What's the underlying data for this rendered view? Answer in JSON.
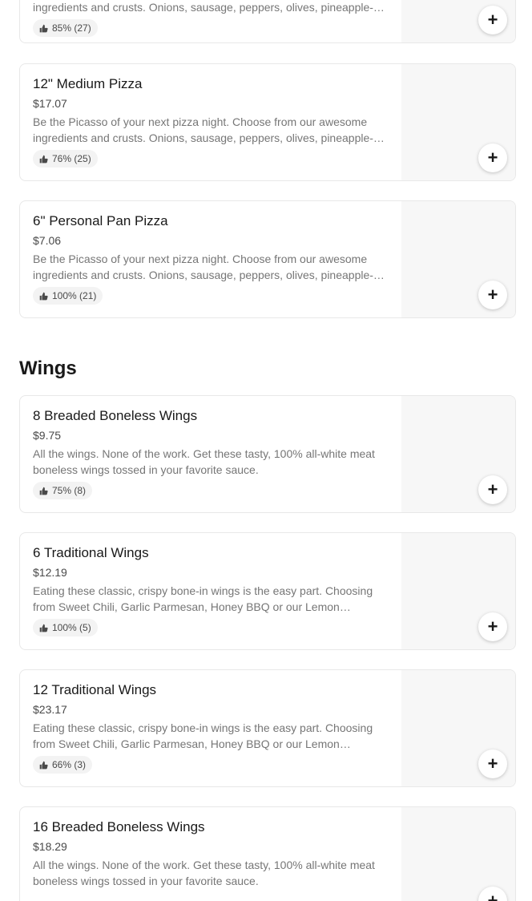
{
  "pizza": {
    "partial_item": {
      "desc": "ingredients and crusts. Onions, sausage, peppers, olives, pineapple-…",
      "rating": "85% (27)"
    },
    "items": [
      {
        "name": "12\" Medium Pizza",
        "price": "$17.07",
        "desc": "Be the Picasso of your next pizza night. Choose from our awesome ingredients and crusts. Onions, sausage, peppers, olives, pineapple-…",
        "rating": "76% (25)"
      },
      {
        "name": "6\" Personal Pan Pizza",
        "price": "$7.06",
        "desc": "Be the Picasso of your next pizza night. Choose from our awesome ingredients and crusts. Onions, sausage, peppers, olives, pineapple-…",
        "rating": "100% (21)"
      }
    ]
  },
  "wings": {
    "title": "Wings",
    "items": [
      {
        "name": "8 Breaded Boneless Wings",
        "price": "$9.75",
        "desc": "All the wings. None of the work. Get these tasty, 100% all-white meat boneless wings tossed in your favorite sauce.",
        "rating": "75% (8)"
      },
      {
        "name": "6 Traditional Wings",
        "price": "$12.19",
        "desc": "Eating these classic, crispy bone-in wings is the easy part. Choosing from Sweet Chili, Garlic Parmesan, Honey BBQ or our Lemon…",
        "rating": "100% (5)"
      },
      {
        "name": "12 Traditional Wings",
        "price": "$23.17",
        "desc": "Eating these classic, crispy bone-in wings is the easy part. Choosing from Sweet Chili, Garlic Parmesan, Honey BBQ or our Lemon…",
        "rating": "66% (3)"
      },
      {
        "name": "16 Breaded Boneless Wings",
        "price": "$18.29",
        "desc": "All the wings. None of the work. Get these tasty, 100% all-white meat boneless wings tossed in your favorite sauce."
      }
    ]
  },
  "icons": {
    "thumb": "thumbs-up-icon",
    "add": "plus-icon"
  },
  "add_symbol": "+"
}
